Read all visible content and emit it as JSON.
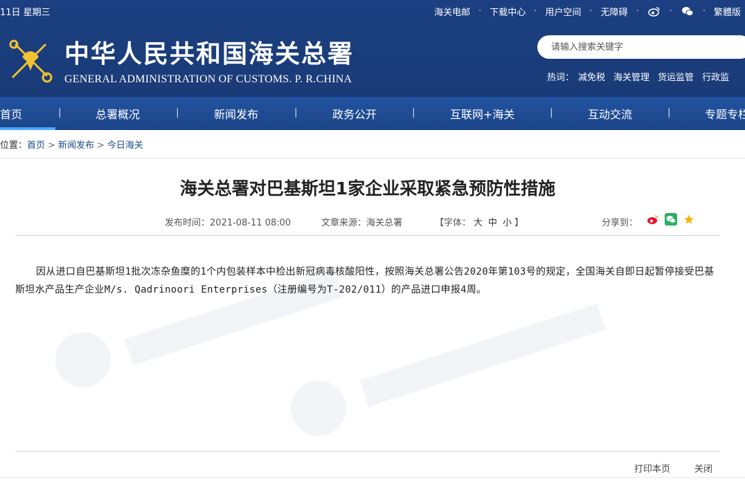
{
  "topbar": {
    "date": "11日 星期三",
    "links": [
      "海关电邮",
      "下载中心",
      "用户空间",
      "无障碍"
    ],
    "trad_label": "繁體版"
  },
  "header": {
    "title_cn": "中华人民共和国海关总署",
    "title_en": "GENERAL ADMINISTRATION OF CUSTOMS. P. R.CHINA",
    "search_placeholder": "请输入搜索关键字",
    "hot_label": "热词：",
    "hot_words": [
      "减免税",
      "海关管理",
      "货运监管",
      "行政监"
    ]
  },
  "nav": {
    "items": [
      "首页",
      "总署概况",
      "新闻发布",
      "政务公开",
      "互联网+海关",
      "互动交流",
      "专题专栏"
    ],
    "active": "首页"
  },
  "breadcrumb": {
    "prefix": "位置：",
    "items": [
      "首页",
      "新闻发布",
      "今日海关"
    ],
    "sep": ">"
  },
  "article": {
    "title": "海关总署对巴基斯坦1家企业采取紧急预防性措施",
    "publish_time": "发布时间：2021-08-11 08:00",
    "source": "文章来源：海关总署",
    "font_label": "【字体：",
    "font_large": "大",
    "font_medium": "中",
    "font_small": "小",
    "font_close": "】",
    "share_label": "分享到：",
    "body": "因从进口自巴基斯坦1批次冻杂鱼糜的1个内包装样本中检出新冠病毒核酸阳性，按照海关总署公告2020年第103号的规定，全国海关自即日起暂停接受巴基斯坦水产品生产企业M/s. Qadrinoori Enterprises（注册编号为T-202/011）的产品进口申报4周。",
    "print_label": "打印本页",
    "close_label": "关闭"
  },
  "icons": {
    "weibo": "weibo-icon",
    "wechat": "wechat-icon",
    "favorite": "star-icon"
  },
  "colors": {
    "header_bg": "#1b3f80",
    "nav_bg": "#1e4a90",
    "active_bar": "#4aa8ff",
    "weibo": "#e6162d",
    "wechat": "#2aae67",
    "star": "#f4b400"
  }
}
